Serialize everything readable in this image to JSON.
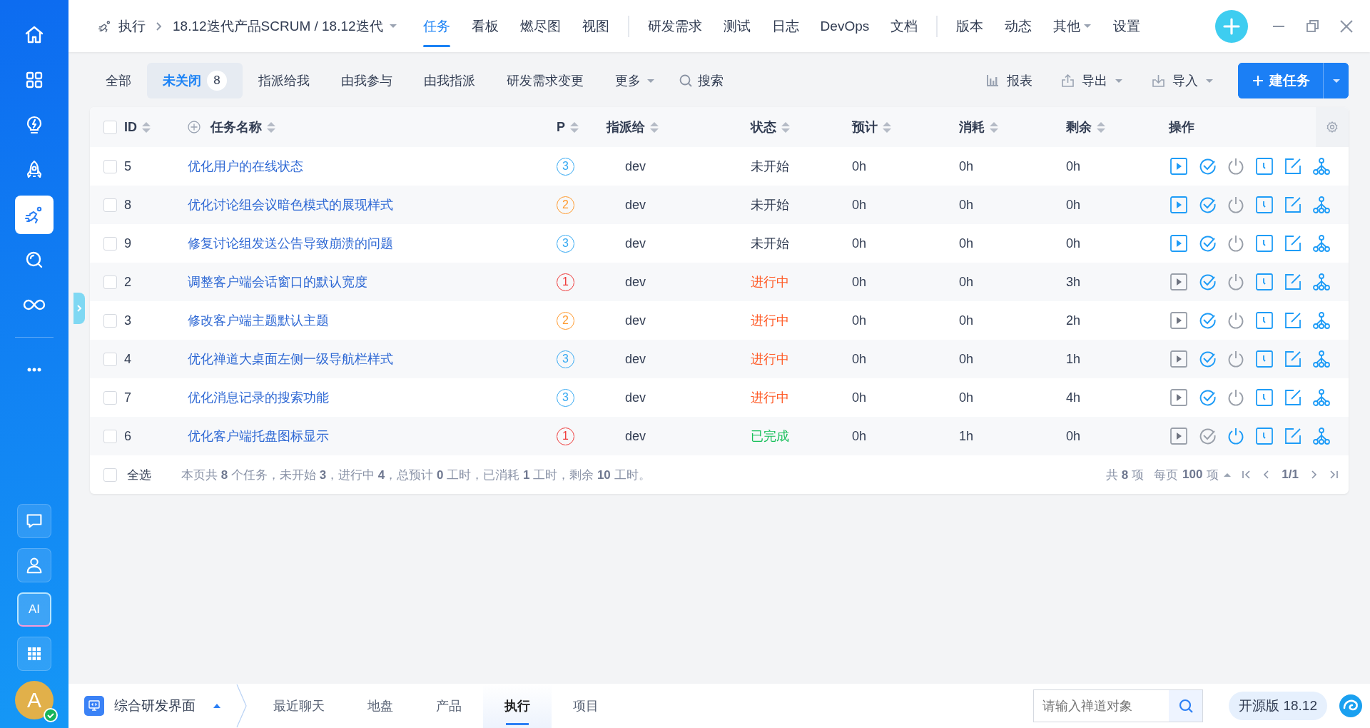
{
  "sidebar": {
    "items": [
      {
        "kind": "home",
        "selected": false
      },
      {
        "kind": "apps",
        "selected": false
      },
      {
        "kind": "idea",
        "selected": false
      },
      {
        "kind": "rocket",
        "selected": false
      },
      {
        "kind": "execution",
        "selected": true
      },
      {
        "kind": "search",
        "selected": false
      },
      {
        "kind": "devops",
        "selected": false
      },
      {
        "kind": "more",
        "selected": false
      }
    ],
    "bottom_items": [
      {
        "kind": "chat"
      },
      {
        "kind": "user"
      },
      {
        "kind": "ai",
        "label": "AI"
      },
      {
        "kind": "apps"
      }
    ],
    "avatar": {
      "initial": "A",
      "online": true
    }
  },
  "topbar": {
    "breadcrumb": {
      "section": "执行",
      "current": "18.12迭代产品SCRUM / 18.12迭代"
    },
    "nav_groups": [
      [
        {
          "label": "任务",
          "selected": true,
          "dropdown": false
        },
        {
          "label": "看板",
          "selected": false,
          "dropdown": false
        },
        {
          "label": "燃尽图",
          "selected": false,
          "dropdown": false
        },
        {
          "label": "视图",
          "selected": false,
          "dropdown": false
        }
      ],
      [
        {
          "label": "研发需求",
          "selected": false,
          "dropdown": false
        },
        {
          "label": "测试",
          "selected": false,
          "dropdown": false
        },
        {
          "label": "日志",
          "selected": false,
          "dropdown": false
        },
        {
          "label": "DevOps",
          "selected": false,
          "dropdown": false
        },
        {
          "label": "文档",
          "selected": false,
          "dropdown": false
        }
      ],
      [
        {
          "label": "版本",
          "selected": false,
          "dropdown": false
        },
        {
          "label": "动态",
          "selected": false,
          "dropdown": false
        },
        {
          "label": "其他",
          "selected": false,
          "dropdown": true
        },
        {
          "label": "设置",
          "selected": false,
          "dropdown": false
        }
      ]
    ]
  },
  "toolbar": {
    "filters": [
      {
        "label": "全部",
        "selected": false,
        "dropdown": false
      },
      {
        "label": "未关闭",
        "selected": true,
        "count": "8",
        "dropdown": false
      },
      {
        "label": "指派给我",
        "selected": false,
        "dropdown": false
      },
      {
        "label": "由我参与",
        "selected": false,
        "dropdown": false
      },
      {
        "label": "由我指派",
        "selected": false,
        "dropdown": false
      },
      {
        "label": "研发需求变更",
        "selected": false,
        "dropdown": false
      },
      {
        "label": "更多",
        "selected": false,
        "dropdown": true
      }
    ],
    "search": {
      "label": "搜索"
    },
    "actions": [
      {
        "kind": "report",
        "label": "报表",
        "dropdown": false
      },
      {
        "kind": "export",
        "label": "导出",
        "dropdown": true
      },
      {
        "kind": "import",
        "label": "导入",
        "dropdown": true
      }
    ],
    "create_button": {
      "label": "建任务"
    }
  },
  "table": {
    "select_all_checked": false,
    "columns": [
      {
        "label": "ID",
        "sortable": true
      },
      {
        "label": "任务名称",
        "sortable": true
      },
      {
        "label": "P",
        "sortable": true
      },
      {
        "label": "指派给",
        "sortable": true
      },
      {
        "label": "状态",
        "sortable": true
      },
      {
        "label": "预计",
        "sortable": true
      },
      {
        "label": "消耗",
        "sortable": true
      },
      {
        "label": "剩余",
        "sortable": true
      },
      {
        "label": "操作",
        "sortable": false
      }
    ],
    "rows": [
      {
        "checked": false,
        "id": "5",
        "name": "优化用户的在线状态",
        "priority": {
          "label": "3",
          "color": "#36a9f2"
        },
        "assigned_to": "dev",
        "status": {
          "label": "未开始",
          "color": "#313c52"
        },
        "estimate": "0h",
        "consumed": "0h",
        "left": "0h",
        "start_disabled": false,
        "finish_disabled": false,
        "close_disabled": true
      },
      {
        "checked": false,
        "id": "8",
        "name": "优化讨论组会议暗色模式的展现样式",
        "priority": {
          "label": "2",
          "color": "#ff9a2e"
        },
        "assigned_to": "dev",
        "status": {
          "label": "未开始",
          "color": "#313c52"
        },
        "estimate": "0h",
        "consumed": "0h",
        "left": "0h",
        "start_disabled": false,
        "finish_disabled": false,
        "close_disabled": true
      },
      {
        "checked": false,
        "id": "9",
        "name": "修复讨论组发送公告导致崩溃的问题",
        "priority": {
          "label": "3",
          "color": "#36a9f2"
        },
        "assigned_to": "dev",
        "status": {
          "label": "未开始",
          "color": "#313c52"
        },
        "estimate": "0h",
        "consumed": "0h",
        "left": "0h",
        "start_disabled": false,
        "finish_disabled": false,
        "close_disabled": true
      },
      {
        "checked": false,
        "id": "2",
        "name": "调整客户端会话窗口的默认宽度",
        "priority": {
          "label": "1",
          "color": "#ef3b3b"
        },
        "assigned_to": "dev",
        "status": {
          "label": "进行中",
          "color": "#ff5a26"
        },
        "estimate": "0h",
        "consumed": "0h",
        "left": "3h",
        "start_disabled": true,
        "finish_disabled": false,
        "close_disabled": true
      },
      {
        "checked": false,
        "id": "3",
        "name": "修改客户端主题默认主题",
        "priority": {
          "label": "2",
          "color": "#ff9a2e"
        },
        "assigned_to": "dev",
        "status": {
          "label": "进行中",
          "color": "#ff5a26"
        },
        "estimate": "0h",
        "consumed": "0h",
        "left": "2h",
        "start_disabled": true,
        "finish_disabled": false,
        "close_disabled": true
      },
      {
        "checked": false,
        "id": "4",
        "name": "优化禅道大桌面左侧一级导航栏样式",
        "priority": {
          "label": "3",
          "color": "#36a9f2"
        },
        "assigned_to": "dev",
        "status": {
          "label": "进行中",
          "color": "#ff5a26"
        },
        "estimate": "0h",
        "consumed": "0h",
        "left": "1h",
        "start_disabled": true,
        "finish_disabled": false,
        "close_disabled": true
      },
      {
        "checked": false,
        "id": "7",
        "name": "优化消息记录的搜索功能",
        "priority": {
          "label": "3",
          "color": "#36a9f2"
        },
        "assigned_to": "dev",
        "status": {
          "label": "进行中",
          "color": "#ff5a26"
        },
        "estimate": "0h",
        "consumed": "0h",
        "left": "4h",
        "start_disabled": true,
        "finish_disabled": false,
        "close_disabled": true
      },
      {
        "checked": false,
        "id": "6",
        "name": "优化客户端托盘图标显示",
        "priority": {
          "label": "1",
          "color": "#ef3b3b"
        },
        "assigned_to": "dev",
        "status": {
          "label": "已完成",
          "color": "#17bf5a"
        },
        "estimate": "0h",
        "consumed": "1h",
        "left": "0h",
        "start_disabled": true,
        "finish_disabled": true,
        "close_disabled": false
      }
    ],
    "footer": {
      "select_all_label": "全选",
      "summary": "本页共 **8** 个任务，未开始 **3**，进行中 **4**，总预计 **0** 工时，已消耗 **1** 工时，剩余 **10** 工时。",
      "total": "共 **8** 项",
      "per_page": "每页 **100** 项",
      "page": "1/1"
    }
  },
  "bottombar": {
    "app": {
      "label": "综合研发界面"
    },
    "tabs": [
      {
        "label": "最近聊天",
        "selected": false
      },
      {
        "label": "地盘",
        "selected": false
      },
      {
        "label": "产品",
        "selected": false
      },
      {
        "label": "执行",
        "selected": true
      },
      {
        "label": "项目",
        "selected": false
      }
    ],
    "search": {
      "placeholder": "请输入禅道对象"
    },
    "version": "开源版 18.12"
  }
}
